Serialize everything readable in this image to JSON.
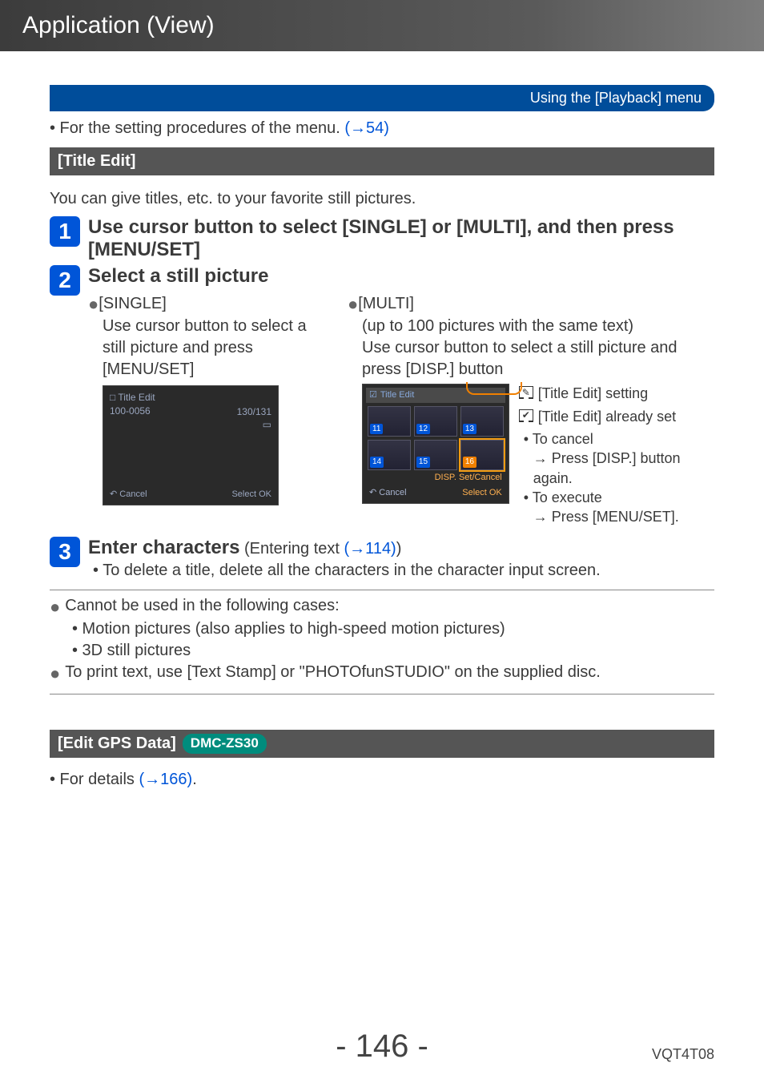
{
  "header": {
    "title": "Application (View)"
  },
  "breadcrumb": "Using the [Playback] menu",
  "menu_proc": {
    "prefix": "• For the setting procedures of the menu. ",
    "link": "(→54)"
  },
  "section": {
    "title": "[Title Edit]"
  },
  "intro": "You can give titles, etc. to your favorite still pictures.",
  "steps": {
    "s1": {
      "num": "1",
      "title": "Use cursor button to select [SINGLE] or [MULTI], and then press [MENU/SET]"
    },
    "s2": {
      "num": "2",
      "title": "Select a still picture",
      "single": {
        "label": "[SINGLE]",
        "desc": "Use cursor button to select a still picture and press [MENU/SET]",
        "ss": {
          "hdr": "Title Edit",
          "id": "100-0056",
          "count": "130/131",
          "cancel": "Cancel",
          "select": "Select  OK"
        }
      },
      "multi": {
        "label": "[MULTI]",
        "note": "(up to 100 pictures with the same text)",
        "desc": "Use cursor button to select a still picture and press [DISP.] button",
        "ss": {
          "hdr": "Title Edit",
          "ids": [
            "11",
            "12",
            "13",
            "14",
            "15",
            "16"
          ],
          "disp": "DISP. Set/Cancel",
          "cancel": "Cancel",
          "select": "Select  OK"
        },
        "legend": {
          "setting": "[Title Edit] setting",
          "already": "[Title Edit] already set",
          "cancel_label": "• To cancel",
          "cancel_action": "→ Press [DISP.] button again.",
          "execute_label": "• To execute",
          "execute_action": "→ Press [MENU/SET]."
        }
      }
    },
    "s3": {
      "num": "3",
      "title": "Enter characters",
      "sub": "(Entering text ",
      "link": "(→114)",
      "close": ")",
      "note": "• To delete a title, delete all the characters in the character input screen."
    }
  },
  "notes": {
    "n1": "Cannot be used in the following cases:",
    "n1a": "• Motion pictures (also applies to high-speed motion pictures)",
    "n1b": "• 3D still pictures",
    "n2": "To print text, use [Text Stamp] or \"PHOTOfunSTUDIO\" on the supplied disc."
  },
  "section2": {
    "title": "[Edit GPS Data]",
    "model": "DMC-ZS30"
  },
  "details": {
    "prefix": "• For details ",
    "link": "(→166)",
    "suffix": "."
  },
  "footer": {
    "page": "- 146 -",
    "code": "VQT4T08"
  }
}
